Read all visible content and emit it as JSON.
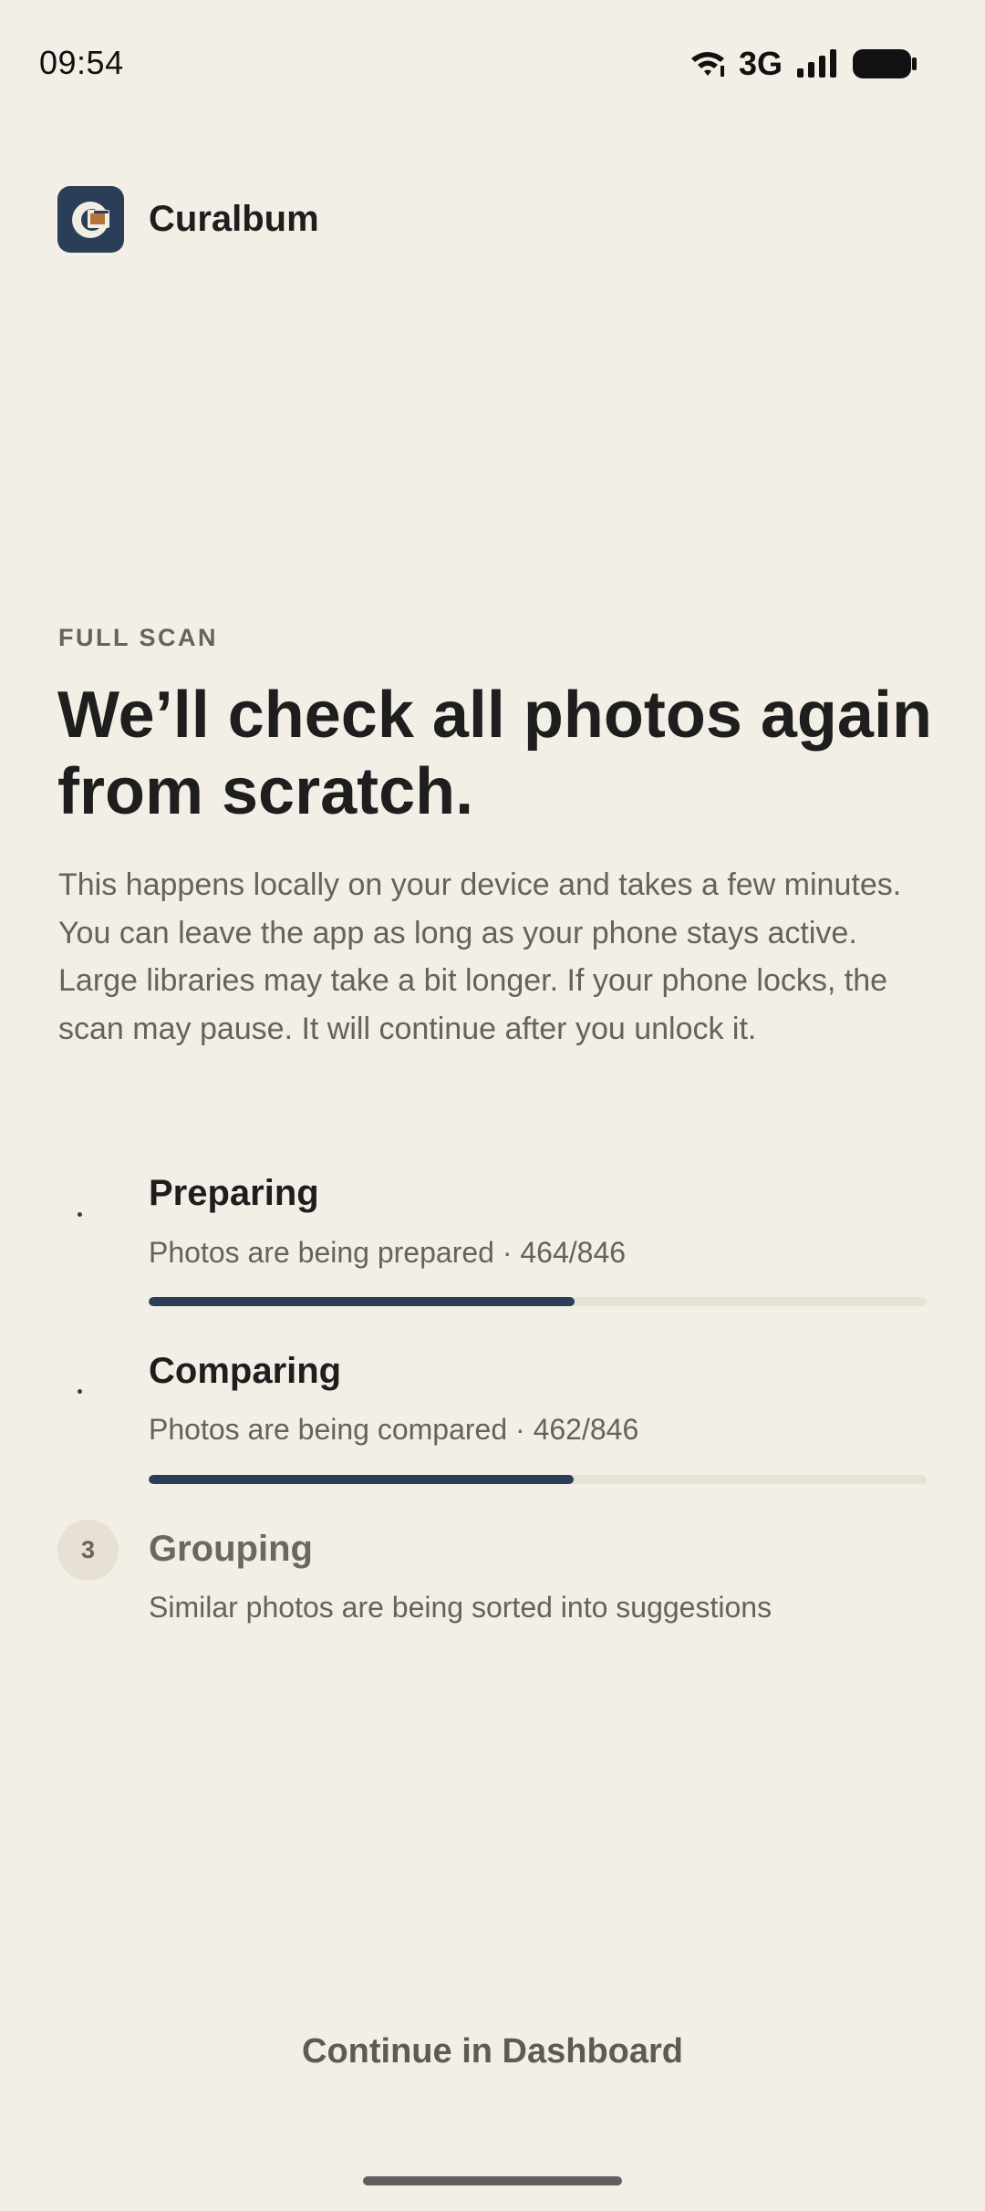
{
  "status_bar": {
    "time": "09:54",
    "network": "3G",
    "icons": [
      "wifi-icon",
      "signal-icon",
      "battery-icon"
    ]
  },
  "app": {
    "name": "Curalbum",
    "logo_icon": "curalbum-logo-icon"
  },
  "content": {
    "eyebrow": "FULL SCAN",
    "headline": "We’ll check all photos again from scratch.",
    "description": "This happens locally on your device and takes a few minutes. You can leave the app as long as your phone stays active. Large libraries may take a bit longer. If your phone locks, the scan may pause. It will continue after you unlock it."
  },
  "steps": [
    {
      "title": "Preparing",
      "subtitle": "Photos are being prepared · 464/846",
      "progress": 0.548,
      "state": "in-progress"
    },
    {
      "title": "Comparing",
      "subtitle": "Photos are being compared · 462/846",
      "progress": 0.546,
      "state": "in-progress"
    },
    {
      "number": "3",
      "title": "Grouping",
      "subtitle": "Similar photos are being sorted into suggestions",
      "state": "pending"
    }
  ],
  "actions": {
    "continue_label": "Continue in Dashboard"
  },
  "colors": {
    "background": "#F3EFE6",
    "accent": "#2B3E57",
    "track": "#E8E2D5",
    "text_primary": "#1E1E1E",
    "text_secondary": "#66625C"
  }
}
